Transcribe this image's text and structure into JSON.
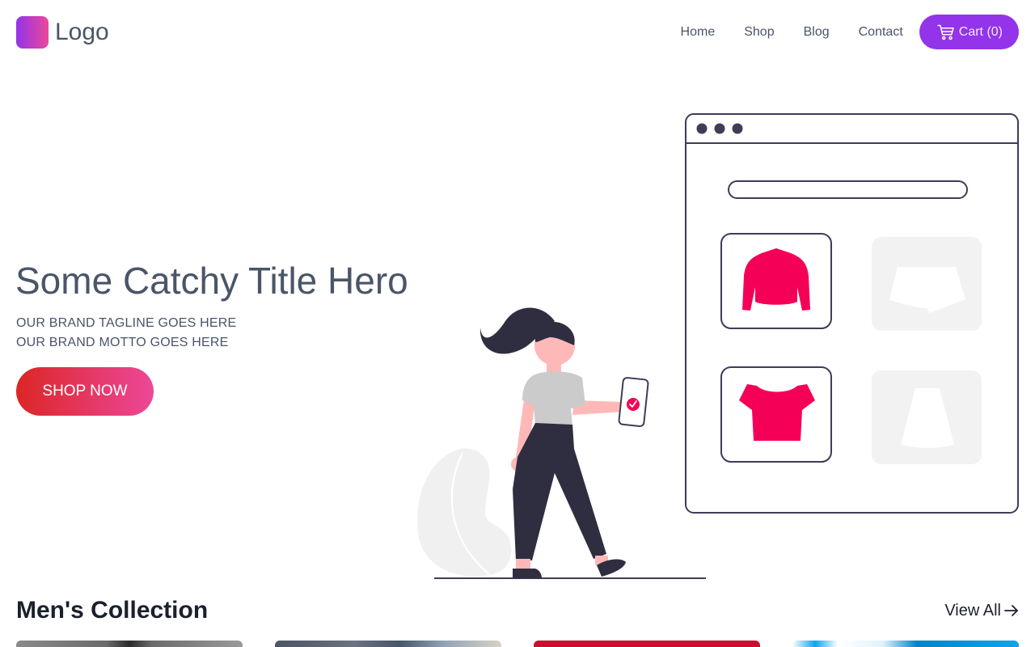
{
  "header": {
    "logo_text": "Logo",
    "nav": [
      "Home",
      "Shop",
      "Blog",
      "Contact"
    ],
    "cart_label": "Cart (0)"
  },
  "hero": {
    "title": "Some Catchy Title Hero",
    "tagline": "OUR BRAND TAGLINE GOES HERE",
    "motto": "OUR BRAND MOTTO GOES HERE",
    "cta_label": "SHOP NOW"
  },
  "collection": {
    "title": "Men's Collection",
    "view_all_label": "View All"
  },
  "colors": {
    "accent": "#9333ea",
    "cta_gradient_start": "#dc2626",
    "cta_gradient_end": "#ec4899",
    "illustration_highlight": "#f50057",
    "illustration_outline": "#3f3d56"
  },
  "icons": {
    "cart": "shopping-cart-icon",
    "view_all": "arrow-right-icon"
  }
}
